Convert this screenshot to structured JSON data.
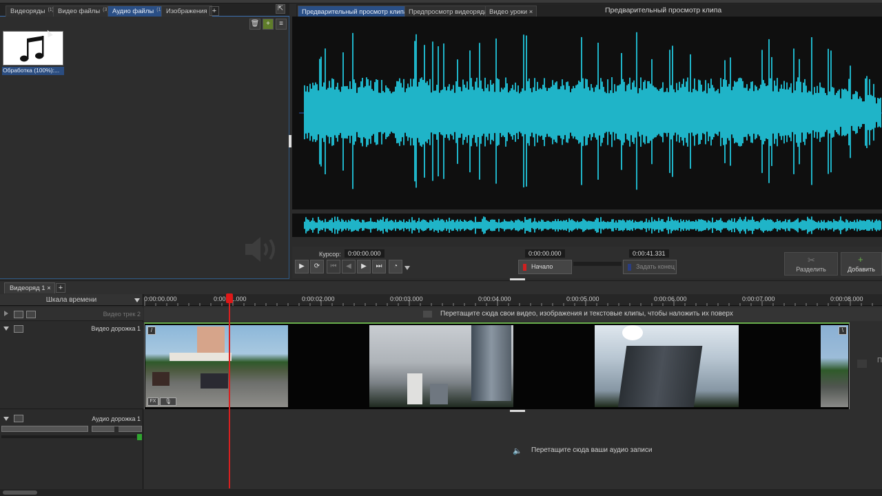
{
  "media_panel": {
    "tabs": [
      {
        "label": "Видеоряды",
        "count": "(1)"
      },
      {
        "label": "Видео файлы",
        "count": "(3)"
      },
      {
        "label": "Аудио файлы",
        "count": "(1)"
      },
      {
        "label": "Изображения",
        "count": ""
      }
    ],
    "add_tab_label": "+",
    "item_label": "Обработка (100%):..."
  },
  "preview": {
    "tabs": [
      "Предварительный просмотр клипа",
      "Предпросмотр видеоряда",
      "Видео уроки"
    ],
    "close_label": "×",
    "title": "Предварительный просмотр клипа",
    "cursor_label": "Курсор:",
    "cursor_value": "0:00:00.000",
    "start_value": "0:00:00.000",
    "end_value": "0:00:41.331",
    "start_button": "Начало",
    "set_end_button": "Задать конец",
    "split_button": "Разделить",
    "add_button": "Добавить",
    "waveform_color": "#1fb4c8"
  },
  "timeline": {
    "tab_label": "Видеоряд 1",
    "tab_close": "×",
    "add_label": "+",
    "scale_label": "Шкала времени",
    "ruler_labels": [
      "0:00:00.000",
      "0:00:01.000",
      "0:00:02.000",
      "0:00:03.000",
      "0:00:04.000",
      "0:00:05.000",
      "0:00:06.000",
      "0:00:07.000",
      "0:00:08.000"
    ],
    "overlay_track_name": "Видео трек 2",
    "overlay_hint": "Перетащите сюда свои видео, изображения и текстовые клипы, чтобы наложить их поверх",
    "video_track_name": "Видео дорожка 1",
    "audio_track_name": "Аудио дорожка 1",
    "audio_hint": "Перетащите сюда ваши аудио записи",
    "fx_label": "FX",
    "right_cut_label": "П",
    "accent_color": "#6ab04c",
    "playhead_color": "#e01818"
  }
}
